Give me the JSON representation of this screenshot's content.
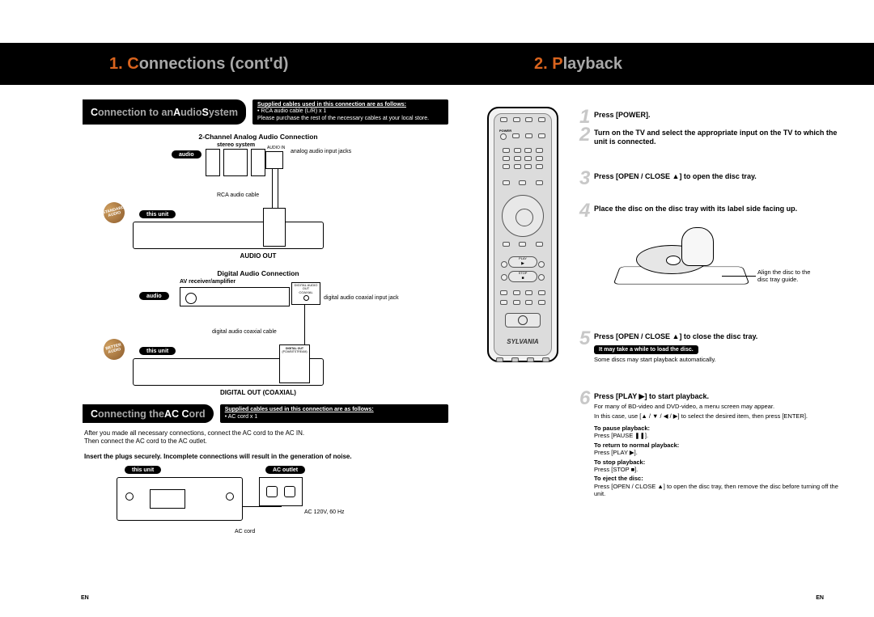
{
  "header_left_highlight": "1. C",
  "header_left_rest": "onnections (cont'd)",
  "header_right_highlight": "2. P",
  "header_right_rest": "layback",
  "leftPage": {
    "sub1_a": "C",
    "sub1_b": "onnection to an ",
    "sub1_c": "A",
    "sub1_d": "udio ",
    "sub1_e": "S",
    "sub1_f": "ystem",
    "info1_underline": "Supplied cables used in this connection are as follows:",
    "info1_line2": "• RCA audio cable (L/R) x 1",
    "info1_line3": "Please purchase the rest of the necessary cables at your local store.",
    "analog_title": "2-Channel Analog Audio Connection",
    "stereo_system": "stereo system",
    "audio_in": "AUDIO IN",
    "analog_jacks": "analog audio input jacks",
    "audio_pill": "audio",
    "rca_cable": "RCA audio cable",
    "this_unit": "this unit",
    "badge_standard": "STANDARD AUDIO",
    "audio_out": "AUDIO OUT",
    "digital_title": "Digital Audio Connection",
    "av_receiver": "AV receiver/amplifier",
    "digital_jack": "digital audio coaxial input jack",
    "digital_cable": "digital audio coaxial cable",
    "badge_better": "BETTER AUDIO",
    "digital_out": "DIGITAL OUT (COAXIAL)",
    "sub2_a": "C",
    "sub2_b": "onnecting the ",
    "sub2_c": "AC C",
    "sub2_d": "ord",
    "info2_underline": "Supplied cables used in this connection are as follows:",
    "info2_line2": "• AC cord x 1",
    "ac_para1": "After you made all necessary connections, connect the AC cord to the AC IN.",
    "ac_para2": "Then connect the AC cord to the AC outlet.",
    "ac_bold": "Insert the plugs securely. Incomplete connections will result in the generation of noise.",
    "ac_outlet": "AC outlet",
    "ac_cord": "AC cord",
    "ac_volt": "AC 120V, 60 Hz",
    "digital_audio_out_box": "DIGITAL AUDIO OUT",
    "coaxial_box": "COAXIAL",
    "digital_out_box_top": "DIGITAL OUT",
    "digital_out_box_sub": "(PCM/BITSTREAM)"
  },
  "rightPage": {
    "steps": [
      {
        "num": "1",
        "text": "Press [POWER]."
      },
      {
        "num": "2",
        "text": "Turn on the TV and select the appropriate input on the TV to which the unit is connected."
      },
      {
        "num": "3",
        "text": "Press [OPEN / CLOSE ▲] to open the disc tray."
      },
      {
        "num": "4",
        "text": "Place the disc on the disc tray with its label side facing up."
      },
      {
        "num": "5",
        "text": "Press [OPEN / CLOSE ▲] to close the disc tray."
      },
      {
        "num": "6",
        "text": "Press [PLAY ▶] to start playback."
      }
    ],
    "align_note": "Align the disc to the disc tray guide.",
    "note_black": "It may take a while to load the disc.",
    "auto_note": "Some discs may start playback automatically.",
    "s6_a": "For many of BD-video and DVD-video, a menu screen may appear.",
    "s6_b": "In this case, use [▲ / ▼ / ◀ / ▶] to select the desired item, then press [ENTER].",
    "pause_h": "To pause playback:",
    "pause_t": "Press [PAUSE ❚❚].",
    "return_h": "To return to normal playback:",
    "return_t": "Press [PLAY ▶].",
    "stop_h": "To stop playback:",
    "stop_t": "Press [STOP ■].",
    "eject_h": "To eject the disc:",
    "eject_t": "Press [OPEN / CLOSE ▲] to open the disc tray, then remove the disc before turning off the unit.",
    "remote_brand": "SYLVANIA",
    "remote_play": "PLAY",
    "remote_stop": "STOP",
    "remote_play_sym": "▶",
    "remote_stop_sym": "■",
    "remote_power": "POWER"
  },
  "en": "EN"
}
